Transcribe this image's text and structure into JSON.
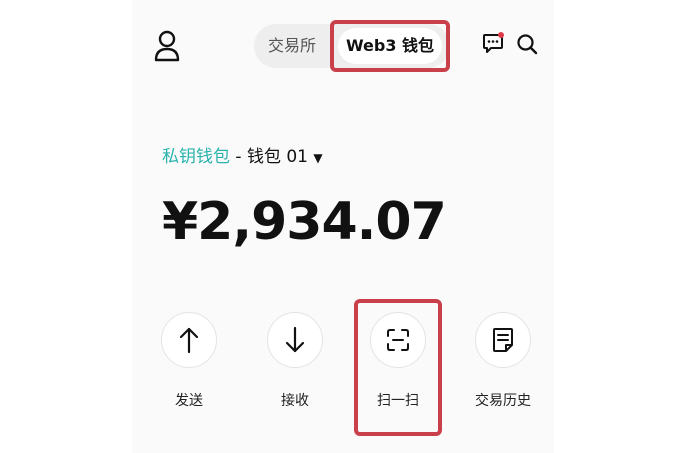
{
  "header": {
    "tabs": [
      {
        "label": "交易所",
        "active": false
      },
      {
        "label": "Web3 钱包",
        "active": true
      }
    ],
    "icons": [
      "user-icon",
      "message-icon",
      "search-icon"
    ]
  },
  "wallet": {
    "type_label": "私钥钱包",
    "separator": " - ",
    "name": "钱包 01",
    "caret": "▼",
    "balance": "¥2,934.07"
  },
  "actions": [
    {
      "label": "发送",
      "icon": "arrow-up-icon"
    },
    {
      "label": "接收",
      "icon": "arrow-down-icon"
    },
    {
      "label": "扫一扫",
      "icon": "scan-icon",
      "highlighted": true
    },
    {
      "label": "交易历史",
      "icon": "document-icon"
    }
  ],
  "colors": {
    "accent_teal": "#2ab3ad",
    "highlight_red": "#c9404a"
  }
}
